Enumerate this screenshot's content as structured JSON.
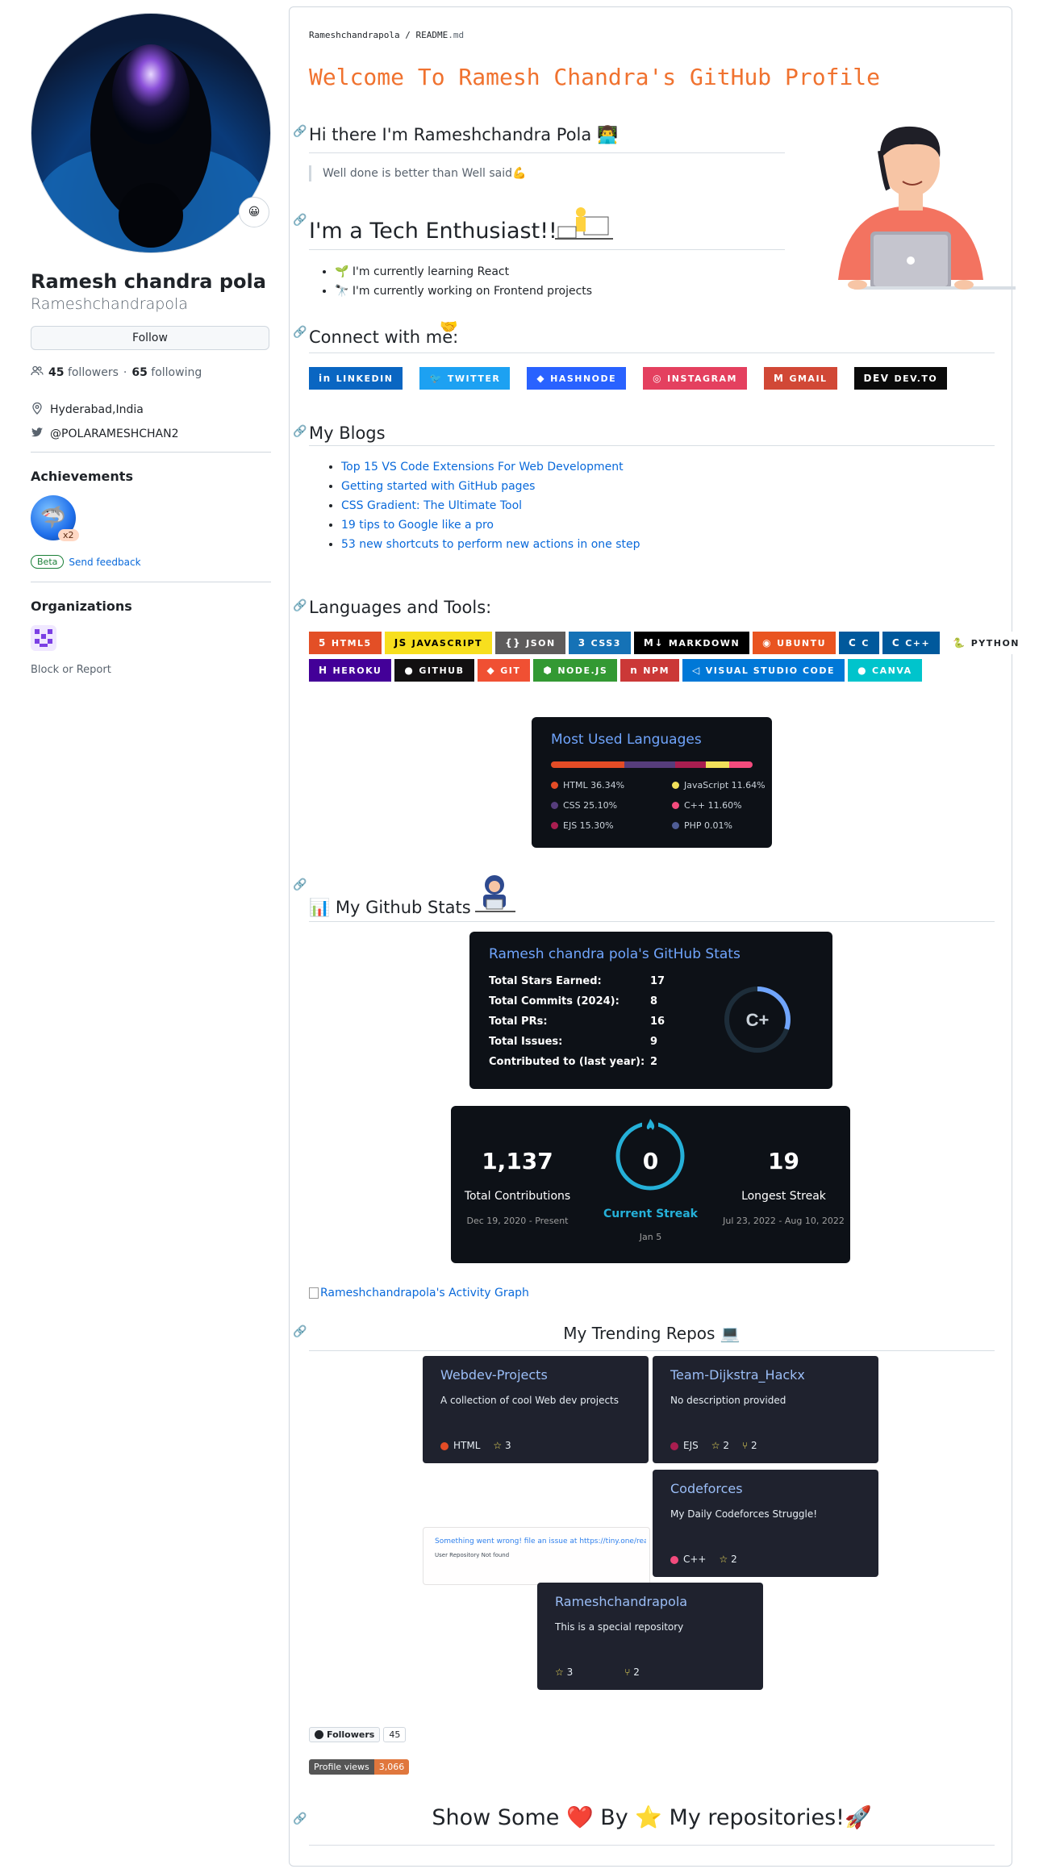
{
  "sidebar": {
    "name": "Ramesh chandra pola",
    "login": "Rameshchandrapola",
    "status_emoji": "😀",
    "follow_label": "Follow",
    "followers_count": "45",
    "followers_label": "followers",
    "separator": "·",
    "following_count": "65",
    "following_label": "following",
    "location": "Hyderabad,India",
    "twitter": "@POLARAMESHCHAN2",
    "achievements_heading": "Achievements",
    "achievement_count": "x2",
    "beta_label": "Beta",
    "feedback_label": "Send feedback",
    "organizations_heading": "Organizations",
    "block_label": "Block or Report"
  },
  "readme": {
    "path_user": "Rameshchandrapola",
    "path_sep": " / ",
    "path_file": "README",
    "path_ext": ".md",
    "title": "Welcome To Ramesh Chandra's GitHub Profile",
    "hi_heading": "Hi there I'm Rameshchandra Pola",
    "hi_emoji": "👨‍💻",
    "quote": "Well done is better than Well said💪",
    "tech_heading": "I'm a Tech Enthusiast!!",
    "bullets": [
      "🌱 I'm currently learning React",
      "🔭 I'm currently working on Frontend projects"
    ],
    "connect_heading": "Connect with me:",
    "connect_badges": [
      {
        "label": "LINKEDIN",
        "color": "#0a66c2",
        "icon": "in"
      },
      {
        "label": "TWITTER",
        "color": "#1da1f2",
        "icon": "🐦"
      },
      {
        "label": "HASHNODE",
        "color": "#2962ff",
        "icon": "◆"
      },
      {
        "label": "INSTAGRAM",
        "color": "#e4405f",
        "icon": "◎"
      },
      {
        "label": "GMAIL",
        "color": "#d14836",
        "icon": "M"
      },
      {
        "label": "DEV.TO",
        "color": "#0a0a0a",
        "icon": "DEV"
      }
    ],
    "blogs_heading": "My Blogs",
    "blogs": [
      "Top 15 VS Code Extensions For Web Development",
      "Getting started with GitHub pages",
      "CSS Gradient: The Ultimate Tool",
      "19 tips to Google like a pro",
      "53 new shortcuts to perform new actions in one step"
    ],
    "tools_heading": "Languages and Tools:",
    "tools_row1": [
      {
        "label": "HTML5",
        "color": "#e34f26",
        "text": "#ffffff",
        "icon": "5"
      },
      {
        "label": "JAVASCRIPT",
        "color": "#f7df1e",
        "text": "#000000",
        "icon": "JS"
      },
      {
        "label": "JSON",
        "color": "#5e5c5c",
        "text": "#ffffff",
        "icon": "{}"
      },
      {
        "label": "CSS3",
        "color": "#1572b6",
        "text": "#ffffff",
        "icon": "3"
      },
      {
        "label": "MARKDOWN",
        "color": "#000000",
        "text": "#ffffff",
        "icon": "M↓"
      },
      {
        "label": "UBUNTU",
        "color": "#e95420",
        "text": "#ffffff",
        "icon": "◉"
      },
      {
        "label": "C",
        "color": "#00599c",
        "text": "#ffffff",
        "icon": "C"
      },
      {
        "label": "C++",
        "color": "#00599c",
        "text": "#ffffff",
        "icon": "C"
      },
      {
        "label": "PYTHON",
        "color": "#ffffff",
        "text": "#1f2328",
        "icon": "🐍"
      }
    ],
    "tools_row2": [
      {
        "label": "HEROKU",
        "color": "#430098",
        "text": "#ffffff",
        "icon": "H"
      },
      {
        "label": "GITHUB",
        "color": "#121011",
        "text": "#ffffff",
        "icon": "●"
      },
      {
        "label": "GIT",
        "color": "#f05033",
        "text": "#ffffff",
        "icon": "◆"
      },
      {
        "label": "NODE.JS",
        "color": "#339933",
        "text": "#ffffff",
        "icon": "⬢"
      },
      {
        "label": "NPM",
        "color": "#cb3837",
        "text": "#ffffff",
        "icon": "n"
      },
      {
        "label": "VISUAL STUDIO CODE",
        "color": "#0078d7",
        "text": "#ffffff",
        "icon": "◁"
      },
      {
        "label": "CANVA",
        "color": "#00c4cc",
        "text": "#ffffff",
        "icon": "●"
      }
    ],
    "langs_card": {
      "title": "Most Used Languages",
      "items": [
        {
          "name": "HTML",
          "pct": 36.34,
          "label": "HTML 36.34%",
          "color": "#e34c26"
        },
        {
          "name": "JavaScript",
          "pct": 11.64,
          "label": "JavaScript 11.64%",
          "color": "#f1e05a"
        },
        {
          "name": "CSS",
          "pct": 25.1,
          "label": "CSS 25.10%",
          "color": "#563d7c"
        },
        {
          "name": "C++",
          "pct": 11.6,
          "label": "C++ 11.60%",
          "color": "#f34b7d"
        },
        {
          "name": "EJS",
          "pct": 15.3,
          "label": "EJS 15.30%",
          "color": "#a91e50"
        },
        {
          "name": "PHP",
          "pct": 0.01,
          "label": "PHP 0.01%",
          "color": "#4f5d95"
        }
      ]
    },
    "stats_heading": "My Github Stats",
    "stats_heading_emoji": "📊",
    "stats_card": {
      "title": "Ramesh chandra pola's GitHub Stats",
      "rows": [
        {
          "label": "Total Stars Earned:",
          "value": "17"
        },
        {
          "label": "Total Commits (2024):",
          "value": "8"
        },
        {
          "label": "Total PRs:",
          "value": "16"
        },
        {
          "label": "Total Issues:",
          "value": "9"
        },
        {
          "label": "Contributed to (last year):",
          "value": "2"
        }
      ],
      "grade": "C+",
      "ring_level": 0.3
    },
    "streak_card": {
      "total": "1,137",
      "total_label": "Total Contributions",
      "total_range": "Dec 19, 2020 - Present",
      "current": "0",
      "current_label": "Current Streak",
      "current_date": "Jan 5",
      "longest": "19",
      "longest_label": "Longest Streak",
      "longest_range": "Jul 23, 2022 - Aug 10, 2022"
    },
    "activity_link": "Rameshchandrapola's Activity Graph",
    "repos_heading": "My Trending Repos",
    "repos_emoji": "💻",
    "repos": [
      {
        "name": "Webdev-Projects",
        "desc": "A collection of cool Web dev projects",
        "lang": "HTML",
        "lang_color": "#e34c26",
        "stars": "3",
        "forks": ""
      },
      {
        "name": "Team-Dijkstra_Hackx",
        "desc": "No description provided",
        "lang": "EJS",
        "lang_color": "#a91e50",
        "stars": "2",
        "forks": "2"
      },
      {
        "name": "Codeforces",
        "desc": "My Daily Codeforces Struggle!",
        "lang": "C++",
        "lang_color": "#f34b7d",
        "stars": "2",
        "forks": ""
      },
      {
        "name": "Rameshchandrapola",
        "desc": "This is a special repository",
        "lang": "",
        "lang_color": "",
        "stars": "3",
        "forks": "2"
      }
    ],
    "error_card": {
      "message": "Something went wrong! file an issue at https://tiny.one/readme-",
      "detail": "User Repository Not found"
    },
    "followers_badge_label": "Followers",
    "followers_badge_count": "45",
    "views_label": "Profile views",
    "views_count": "3,066",
    "show_love": {
      "p1": "Show Some",
      "heart": "❤️",
      "p2": "By",
      "star": "⭐",
      "p3": "My repositories!",
      "rocket": "🚀"
    }
  }
}
